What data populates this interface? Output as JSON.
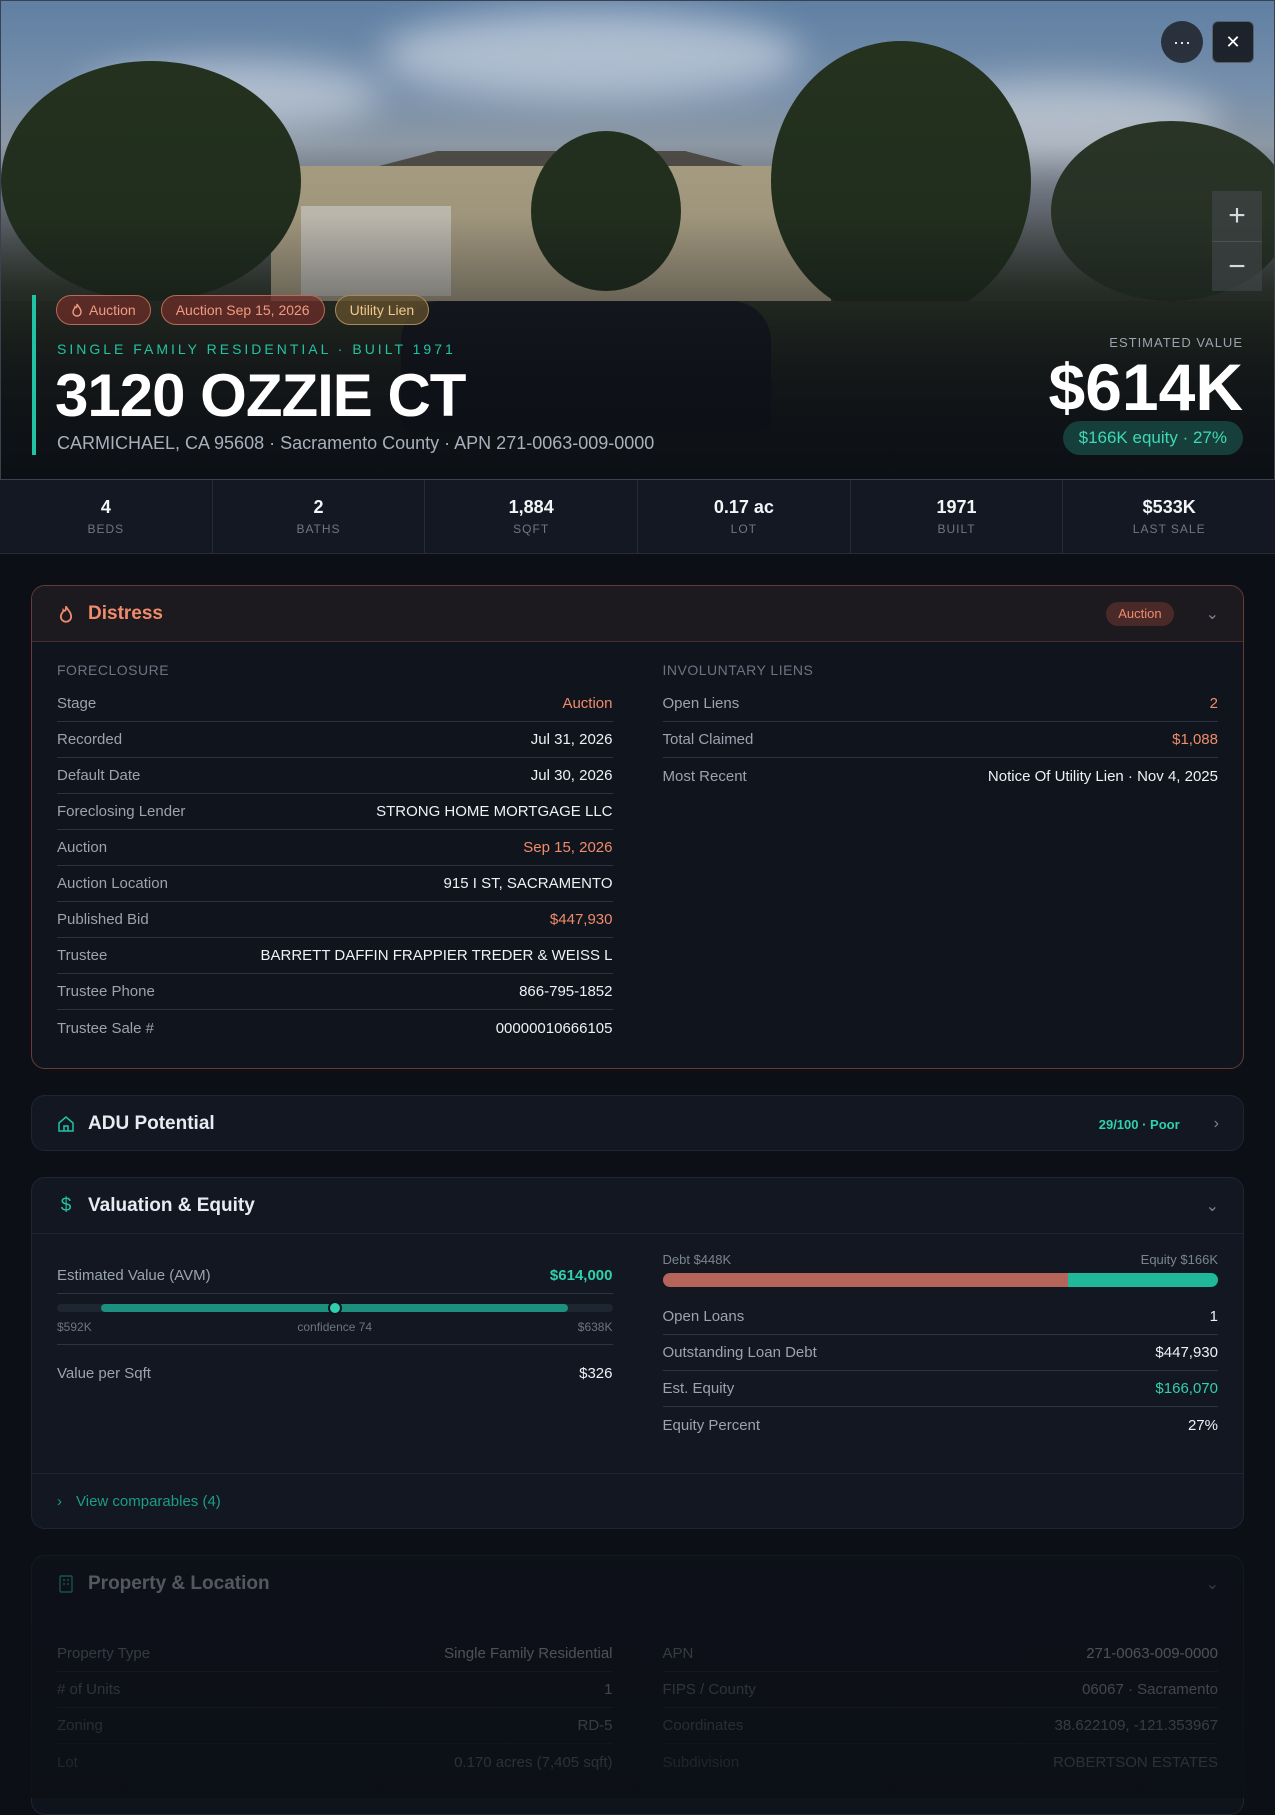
{
  "hero": {
    "tags": [
      {
        "label": "Auction",
        "icon": "flame-icon"
      },
      {
        "label": "Auction Sep 15, 2026"
      },
      {
        "label": "Utility Lien"
      }
    ],
    "eyebrow": "SINGLE FAMILY RESIDENTIAL · BUILT 1971",
    "address": "3120 OZZIE CT",
    "subline": "CARMICHAEL, CA 95608 · Sacramento County · APN 271-0063-009-0000",
    "estimated_label": "ESTIMATED VALUE",
    "estimated_value": "$614K",
    "equity_pill": "$166K equity · 27%",
    "more_glyph": "···",
    "close_glyph": "✕",
    "zoom_in": "+",
    "zoom_out": "−"
  },
  "stats": [
    {
      "value": "4",
      "label": "BEDS"
    },
    {
      "value": "2",
      "label": "BATHS"
    },
    {
      "value": "1,884",
      "label": "SQFT"
    },
    {
      "value": "0.17 ac",
      "label": "LOT"
    },
    {
      "value": "1971",
      "label": "BUILT"
    },
    {
      "value": "$533K",
      "label": "LAST SALE"
    }
  ],
  "distress": {
    "title": "Distress",
    "badge": "Auction",
    "foreclosure": {
      "heading": "FORECLOSURE",
      "rows": [
        {
          "k": "Stage",
          "v": "Auction"
        },
        {
          "k": "Recorded",
          "v": "Jul 31, 2026"
        },
        {
          "k": "Default Date",
          "v": "Jul 30, 2026"
        },
        {
          "k": "Foreclosing Lender",
          "v": "STRONG HOME MORTGAGE LLC"
        },
        {
          "k": "Auction",
          "v": "Sep 15, 2026"
        },
        {
          "k": "Auction Location",
          "v": "915 I ST, SACRAMENTO"
        },
        {
          "k": "Published Bid",
          "v": "$447,930"
        },
        {
          "k": "Trustee",
          "v": "BARRETT DAFFIN FRAPPIER TREDER & WEISS L"
        },
        {
          "k": "Trustee Phone",
          "v": "866-795-1852"
        },
        {
          "k": "Trustee Sale #",
          "v": "00000010666105"
        }
      ]
    },
    "liens": {
      "heading": "INVOLUNTARY LIENS",
      "rows": [
        {
          "k": "Open Liens",
          "v": "2"
        },
        {
          "k": "Total Claimed",
          "v": "$1,088"
        },
        {
          "k": "Most Recent",
          "v": "Notice Of Utility Lien · Nov 4, 2025"
        }
      ]
    }
  },
  "adu": {
    "title": "ADU Potential",
    "score": "29/100 · Poor"
  },
  "valuation": {
    "title": "Valuation & Equity",
    "avm_label": "Estimated Value (AVM)",
    "avm_value": "$614,000",
    "range_low": "$592K",
    "confidence": "confidence 74",
    "range_high": "$638K",
    "range_position_pct": 50,
    "value_per_sqft_label": "Value per Sqft",
    "value_per_sqft": "$326",
    "debt_label": "Debt $448K",
    "equity_label": "Equity $166K",
    "debt_fraction": 0.73,
    "rows": [
      {
        "k": "Open Loans",
        "v": "1"
      },
      {
        "k": "Outstanding Loan Debt",
        "v": "$447,930"
      },
      {
        "k": "Est. Equity",
        "v": "$166,070"
      },
      {
        "k": "Equity Percent",
        "v": "27%"
      }
    ],
    "comparables_link": "View comparables (4)"
  },
  "property": {
    "title": "Property & Location",
    "left_rows": [
      {
        "k": "Property Type",
        "v": "Single Family Residential"
      },
      {
        "k": "# of Units",
        "v": "1"
      },
      {
        "k": "Zoning",
        "v": "RD-5"
      },
      {
        "k": "Lot",
        "v": "0.170 acres (7,405 sqft)"
      }
    ],
    "right_rows": [
      {
        "k": "APN",
        "v": "271-0063-009-0000"
      },
      {
        "k": "FIPS / County",
        "v": "06067 · Sacramento"
      },
      {
        "k": "Coordinates",
        "v": "38.622109, -121.353967"
      },
      {
        "k": "Subdivision",
        "v": "ROBERTSON ESTATES"
      }
    ]
  },
  "colors": {
    "accent": "#22c3a4",
    "distress": "#f08b6b",
    "debt": "#b5645a",
    "equity": "#1fb89a"
  }
}
